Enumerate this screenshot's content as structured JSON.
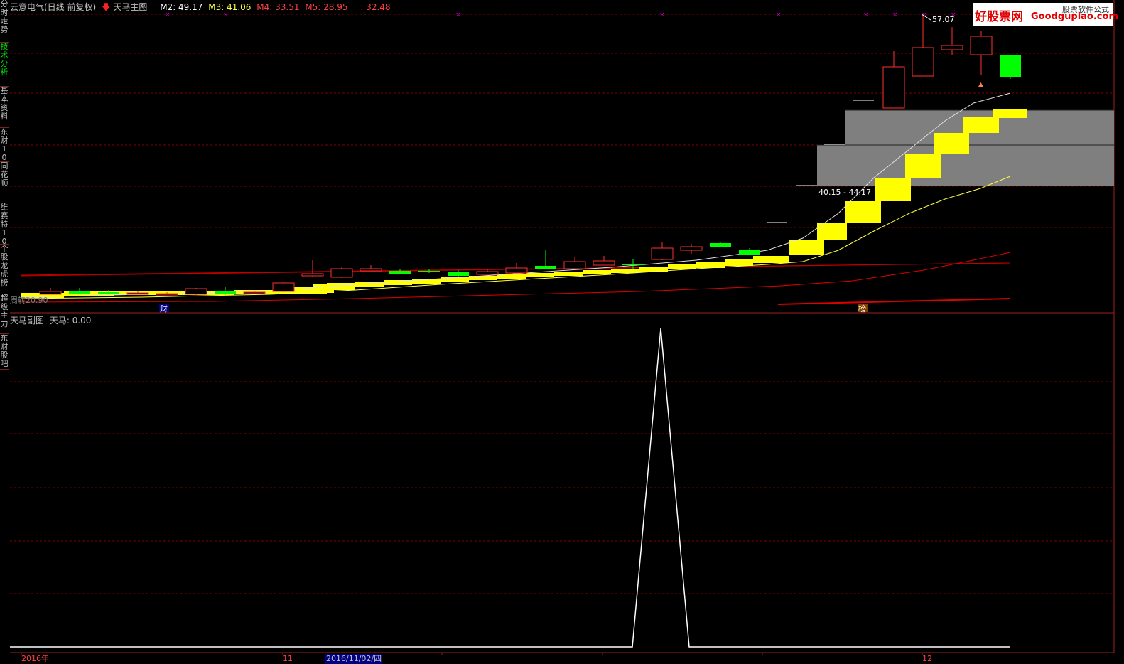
{
  "sidebar": {
    "tabs": [
      {
        "label": "分时走势",
        "active": false
      },
      {
        "label": "技术分析",
        "active": true
      },
      {
        "label": "基本资料",
        "active": false
      },
      {
        "label": "东财10",
        "active": false
      },
      {
        "label": "同花顺",
        "active": false
      },
      {
        "label": "维赛特10",
        "active": false
      },
      {
        "label": "个股龙虎榜",
        "active": false
      },
      {
        "label": "超级主力",
        "active": false
      },
      {
        "label": "东财股吧",
        "active": false
      }
    ]
  },
  "header": {
    "stock_title": "云意电气(日线 前复权)",
    "indicator_name": "天马主图",
    "m2": "M2: 49.17",
    "m3": "M3: 41.06",
    "m4": "M4: 33.51",
    "m5": "M5: 28.95",
    "extra": ": 32.48"
  },
  "main_chart": {
    "high_label": "57.07",
    "zone_label": "40.15 - 44.17",
    "left_label": "周转20.90",
    "marker_cai": "财",
    "marker_bang": "榜"
  },
  "sub_chart": {
    "title": "天马副图",
    "value": "天马: 0.00"
  },
  "x_axis": {
    "labels": [
      "2016年",
      "11",
      "2016/11/02/四",
      "12"
    ]
  },
  "watermark": {
    "brand_cn": "好股票网",
    "brand_en": "Goodgupiao.com",
    "tagline": "股票软件公式"
  },
  "colors": {
    "up": "#ff3030",
    "down": "#00ff00",
    "ma_white": "#e0e0e0",
    "ma_yellow": "#ffff40",
    "ma_red": "#e00000",
    "band": "#ffff00",
    "zone": "#808080",
    "grid": "#800000"
  }
}
